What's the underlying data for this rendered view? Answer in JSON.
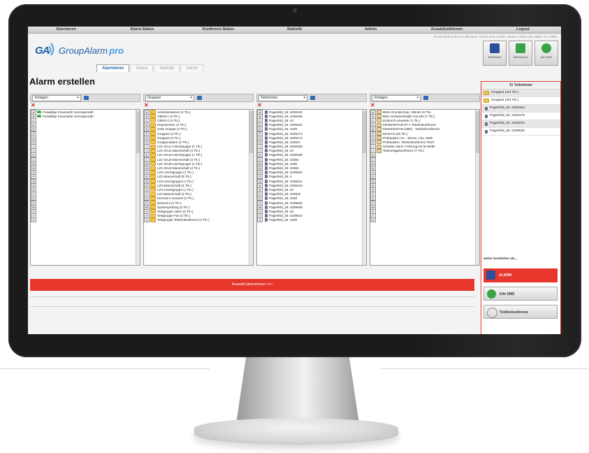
{
  "menu": [
    "Alarmieren",
    "Alarm-Status",
    "Konferenz-Status",
    "Statistik",
    "Admin",
    "Zusatzfunktionen",
    "Logout"
  ],
  "header": {
    "logo_ga": "GA",
    "logo_name": "GroupAlarm",
    "logo_pro": "pro",
    "status_line": "22.04.2015 12:57:54 | Benutzer: Demo ALU, Lizenz: 2015.1 | RGE 128 | Mitte, CH | Hilfe",
    "quick_buttons": [
      {
        "label": "Teilnehmer",
        "color": "#2b4f9a"
      },
      {
        "label": "Telefonbuch",
        "color": "#3ca24a"
      },
      {
        "label": "Info SMS",
        "color": "#37a544"
      }
    ]
  },
  "tabs": [
    "Alarmieren",
    "Status",
    "Statistik",
    "Admin"
  ],
  "page_title": "Alarm erstellen",
  "columns": [
    {
      "dropdown": "Vorlagen",
      "rows": [
        {
          "letter": "A",
          "label": "Freiwillige Feuerwehr Herzogenrath",
          "icon": "group"
        },
        {
          "letter": "B",
          "label": "Freiwillige Feuerwehr Herzogenrath",
          "icon": "group"
        },
        {
          "letter": "C",
          "label": ""
        },
        {
          "letter": "D",
          "label": ""
        },
        {
          "letter": "E",
          "label": ""
        },
        {
          "letter": "F",
          "label": ""
        },
        {
          "letter": "G",
          "label": ""
        },
        {
          "letter": "H",
          "label": ""
        },
        {
          "letter": "I",
          "label": ""
        },
        {
          "letter": "J",
          "label": ""
        },
        {
          "letter": "K",
          "label": ""
        },
        {
          "letter": "L",
          "label": ""
        },
        {
          "letter": "M",
          "label": ""
        },
        {
          "letter": "N",
          "label": ""
        },
        {
          "letter": "O",
          "label": ""
        },
        {
          "letter": "P",
          "label": ""
        },
        {
          "letter": "Q",
          "label": ""
        },
        {
          "letter": "R",
          "label": ""
        },
        {
          "letter": "S",
          "label": ""
        },
        {
          "letter": "T",
          "label": ""
        },
        {
          "letter": "U",
          "label": ""
        },
        {
          "letter": "V",
          "label": ""
        },
        {
          "letter": "W",
          "label": ""
        },
        {
          "letter": "X",
          "label": ""
        },
        {
          "letter": "Y",
          "label": ""
        },
        {
          "letter": "Z",
          "label": ""
        }
      ]
    },
    {
      "dropdown": "Gruppen",
      "rows": [
        {
          "letter": "A",
          "label": "Administratoren (3 Tln.)",
          "icon": "folder"
        },
        {
          "letter": "B",
          "label": "CBRN 1 (3 Tln.)",
          "icon": "folder"
        },
        {
          "letter": "C",
          "label": "CBRN 2 (3 Tln.)",
          "icon": "folder"
        },
        {
          "letter": "D",
          "label": "Disponenten (4 Tln.)",
          "icon": "folder"
        },
        {
          "letter": "E",
          "label": "erste Gruppe (2 Tln.)",
          "icon": "folder"
        },
        {
          "letter": "F",
          "label": "Gruppe1 (4 Tln.)",
          "icon": "folder"
        },
        {
          "letter": "G",
          "label": "Gruppe2 (3 Tln.)",
          "icon": "folder"
        },
        {
          "letter": "H",
          "label": "Gruppenalarm (3 Tln.)",
          "icon": "folder"
        },
        {
          "letter": "I",
          "label": "LZ1-GrU1-Löschgruppe (1 Tln.)",
          "icon": "folder"
        },
        {
          "letter": "J",
          "label": "LZ1-GrU1-Mannschaft (4 Tln.)",
          "icon": "folder"
        },
        {
          "letter": "K",
          "label": "LZ1-GrU2-Löschgruppe (1 Tln.)",
          "icon": "folder"
        },
        {
          "letter": "L",
          "label": "LZ1-GrU2-Mannschaft (4 Tln.)",
          "icon": "folder"
        },
        {
          "letter": "M",
          "label": "LZ1-GrU3-Löschgruppe (1 Tln.)",
          "icon": "folder"
        },
        {
          "letter": "N",
          "label": "LZ1-GrU3-Mannschaft (4 Tln.)",
          "icon": "folder"
        },
        {
          "letter": "O",
          "label": "LZ2-Löschgruppe (1 Tln.)",
          "icon": "folder"
        },
        {
          "letter": "P",
          "label": "LZ2-Mannschaft (6 Tln.)",
          "icon": "folder"
        },
        {
          "letter": "Q",
          "label": "LZ3-Löschgruppe (1 Tln.)",
          "icon": "folder"
        },
        {
          "letter": "R",
          "label": "LZ3-Mannschaft (4 Tln.)",
          "icon": "folder"
        },
        {
          "letter": "S",
          "label": "LZ4-Löschgruppe (1 Tln.)",
          "icon": "folder"
        },
        {
          "letter": "T",
          "label": "LZ4-Mannschaft (3 Tln.)",
          "icon": "folder"
        },
        {
          "letter": "U",
          "label": "Normal-1-neuwert (4 Tln.)",
          "icon": "folder"
        },
        {
          "letter": "V",
          "label": "Normal-2 (2 Tln.)",
          "icon": "folder"
        },
        {
          "letter": "W",
          "label": "Systemprüfung (2 Tln.)",
          "icon": "folder"
        },
        {
          "letter": "X",
          "label": "Testgruppe Alarm (2 Tln.)",
          "icon": "folder"
        },
        {
          "letter": "Y",
          "label": "Testgruppe Fax (2 Tln.)",
          "icon": "folder"
        },
        {
          "letter": "Z",
          "label": "Testgruppe Telefonkonferenz (2 Tln.)",
          "icon": "folder"
        }
      ]
    },
    {
      "dropdown": "Teilnehmer",
      "rows": [
        {
          "letter": "A",
          "label": "Pagerfeld_25: 4339102",
          "icon": "person"
        },
        {
          "letter": "B",
          "label": "Pagerfeld_25: 4339166",
          "icon": "person"
        },
        {
          "letter": "C",
          "label": "Pagerfeld_25: 43",
          "icon": "person"
        },
        {
          "letter": "D",
          "label": "Pagerfeld_25: 4339164",
          "icon": "person"
        },
        {
          "letter": "E",
          "label": "Pagerfeld_25: 4339",
          "icon": "person"
        },
        {
          "letter": "F",
          "label": "Pagerfeld_25: 4339174",
          "icon": "person"
        },
        {
          "letter": "G",
          "label": "Pagerfeld_25: 4339172",
          "icon": "person"
        },
        {
          "letter": "H",
          "label": "Pagerfeld_25: 433917",
          "icon": "person"
        },
        {
          "letter": "I",
          "label": "Pagerfeld_25: 4339180",
          "icon": "person"
        },
        {
          "letter": "J",
          "label": "Pagerfeld_25: 43",
          "icon": "person"
        },
        {
          "letter": "K",
          "label": "Pagerfeld_25: 4339186",
          "icon": "person"
        },
        {
          "letter": "L",
          "label": "Pagerfeld_25: 43381",
          "icon": "person"
        },
        {
          "letter": "M",
          "label": "Pagerfeld_25: 4339",
          "icon": "person"
        },
        {
          "letter": "N",
          "label": "Pagerfeld_25: 43382",
          "icon": "person"
        },
        {
          "letter": "O",
          "label": "Pagerfeld_25: 4339204",
          "icon": "person"
        },
        {
          "letter": "P",
          "label": "Pagerfeld_25: 4",
          "icon": "person"
        },
        {
          "letter": "Q",
          "label": "Pagerfeld_25: 4339212",
          "icon": "person"
        },
        {
          "letter": "R",
          "label": "Pagerfeld_25: 4339216",
          "icon": "person"
        },
        {
          "letter": "S",
          "label": "Pagerfeld_25: 43",
          "icon": "person"
        },
        {
          "letter": "T",
          "label": "Pagerfeld_25: 433922",
          "icon": "person"
        },
        {
          "letter": "U",
          "label": "Pagerfeld_25: 4339",
          "icon": "person"
        },
        {
          "letter": "V",
          "label": "Pagerfeld_25: 4339632",
          "icon": "person"
        },
        {
          "letter": "W",
          "label": "Pagerfeld_25: 4339636",
          "icon": "person"
        },
        {
          "letter": "X",
          "label": "Pagerfeld_25: 43",
          "icon": "person"
        },
        {
          "letter": "Y",
          "label": "Pagerfeld_25: 4339644",
          "icon": "person"
        },
        {
          "letter": "Z",
          "label": "Pagerfeld_25: 4339",
          "icon": "person"
        }
      ]
    },
    {
      "dropdown": "Vorlagen",
      "rows": [
        {
          "letter": "A",
          "label": "BMA-Grundschule, VIBHK-10 Tln.",
          "icon": "doc"
        },
        {
          "letter": "B",
          "label": "BMA-Schwimmhalle CHLOR (7 Tln.)",
          "icon": "doc"
        },
        {
          "letter": "C",
          "label": "Einbruch-Unwetter (1 Tln.)",
          "icon": "doc"
        },
        {
          "letter": "D",
          "label": "KRISENSTAB-ST-1 Telefonkonferenz",
          "icon": "doc"
        },
        {
          "letter": "E",
          "label": "KRISENSTAB (SBK) - Telefonkonferenz",
          "icon": "doc"
        },
        {
          "letter": "F",
          "label": "MANV-5 (25 Tln.)",
          "icon": "doc"
        },
        {
          "letter": "G",
          "label": "Probealarm G1 - Sirene, Fax, SMS",
          "icon": "doc"
        },
        {
          "letter": "H",
          "label": "Probealarm: Telefonkonferenz TEST",
          "icon": "doc"
        },
        {
          "letter": "I",
          "label": "Schieler Alarm: Führung zur B-Stelle",
          "icon": "doc"
        },
        {
          "letter": "J",
          "label": "Testvorlagekonferenz (7 Tln.)",
          "icon": "doc"
        },
        {
          "letter": "K",
          "label": ""
        },
        {
          "letter": "L",
          "label": ""
        },
        {
          "letter": "M",
          "label": ""
        },
        {
          "letter": "N",
          "label": ""
        },
        {
          "letter": "O",
          "label": ""
        },
        {
          "letter": "P",
          "label": ""
        },
        {
          "letter": "Q",
          "label": ""
        },
        {
          "letter": "R",
          "label": ""
        },
        {
          "letter": "S",
          "label": ""
        },
        {
          "letter": "T",
          "label": ""
        },
        {
          "letter": "U",
          "label": ""
        },
        {
          "letter": "V",
          "label": ""
        },
        {
          "letter": "W",
          "label": ""
        },
        {
          "letter": "X",
          "label": ""
        },
        {
          "letter": "Y",
          "label": ""
        },
        {
          "letter": "Z",
          "label": ""
        }
      ]
    }
  ],
  "red_bar_label": "Auswahl übernehmen >>>",
  "right_panel": {
    "header": "31 Teilnehmer",
    "items": [
      {
        "label": "Gruppe1 (4/4 Tln.)",
        "icon": "folder"
      },
      {
        "label": "Gruppe2 (3/3 Tln.)",
        "icon": "folder"
      },
      {
        "label": "Pagerfeld_25: 4339164",
        "icon": "person"
      },
      {
        "label": "Pagerfeld_25: 4339176",
        "icon": "person"
      },
      {
        "label": "Pagerfeld_25: 4339224",
        "icon": "person"
      },
      {
        "label": "Pagerfeld_25: 4339032",
        "icon": "person"
      }
    ],
    "more_label": "weiter bearbeiten als...",
    "buttons": {
      "alarm": "ALARM",
      "info": "Info SMS",
      "tel": "Telefonkonferenz"
    }
  }
}
